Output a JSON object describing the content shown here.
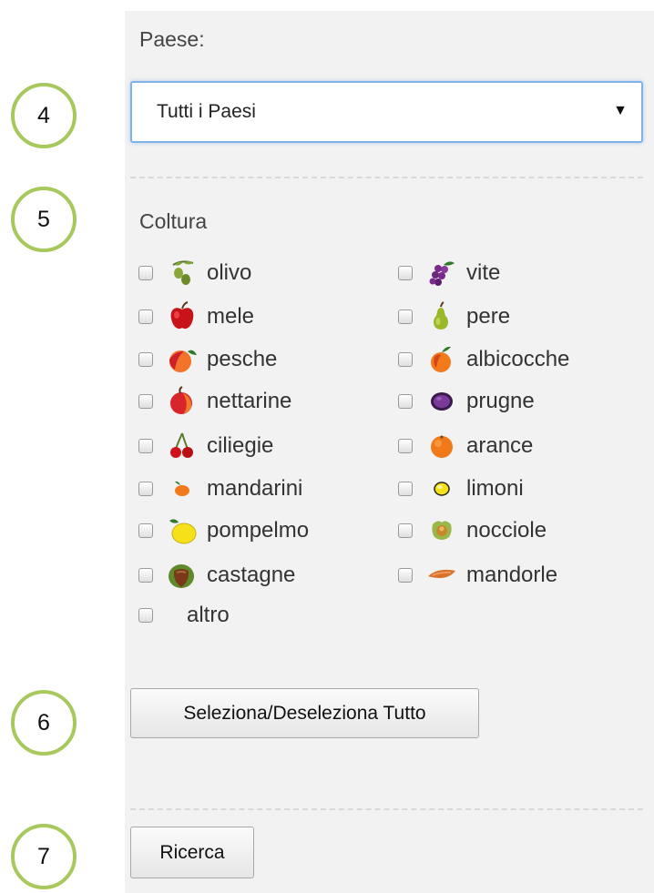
{
  "callouts": [
    "4",
    "5",
    "6",
    "7"
  ],
  "country": {
    "label": "Paese:",
    "selected": "Tutti i Paesi"
  },
  "crops": {
    "label": "Coltura",
    "left": [
      {
        "label": "olivo",
        "icon": "olive-icon"
      },
      {
        "label": "mele",
        "icon": "apple-icon"
      },
      {
        "label": "pesche",
        "icon": "peach-icon"
      },
      {
        "label": "nettarine",
        "icon": "nectarine-icon"
      },
      {
        "label": "ciliegie",
        "icon": "cherry-icon"
      },
      {
        "label": "mandarini",
        "icon": "mandarin-icon"
      },
      {
        "label": "pompelmo",
        "icon": "grapefruit-icon"
      },
      {
        "label": "castagne",
        "icon": "chestnut-icon"
      },
      {
        "label": "altro",
        "icon": ""
      }
    ],
    "right": [
      {
        "label": "vite",
        "icon": "grape-icon"
      },
      {
        "label": "pere",
        "icon": "pear-icon"
      },
      {
        "label": "albicocche",
        "icon": "apricot-icon"
      },
      {
        "label": "prugne",
        "icon": "plum-icon"
      },
      {
        "label": "arance",
        "icon": "orange-icon"
      },
      {
        "label": "limoni",
        "icon": "lemon-icon"
      },
      {
        "label": "nocciole",
        "icon": "hazelnut-icon"
      },
      {
        "label": "mandorle",
        "icon": "almond-icon"
      }
    ]
  },
  "buttons": {
    "toggle_all": "Seleziona/Deseleziona Tutto",
    "search": "Ricerca"
  },
  "colors": {
    "callout_ring": "#a7c85c",
    "panel_bg": "#f2f2f2",
    "select_focus": "#7fb3e6"
  }
}
